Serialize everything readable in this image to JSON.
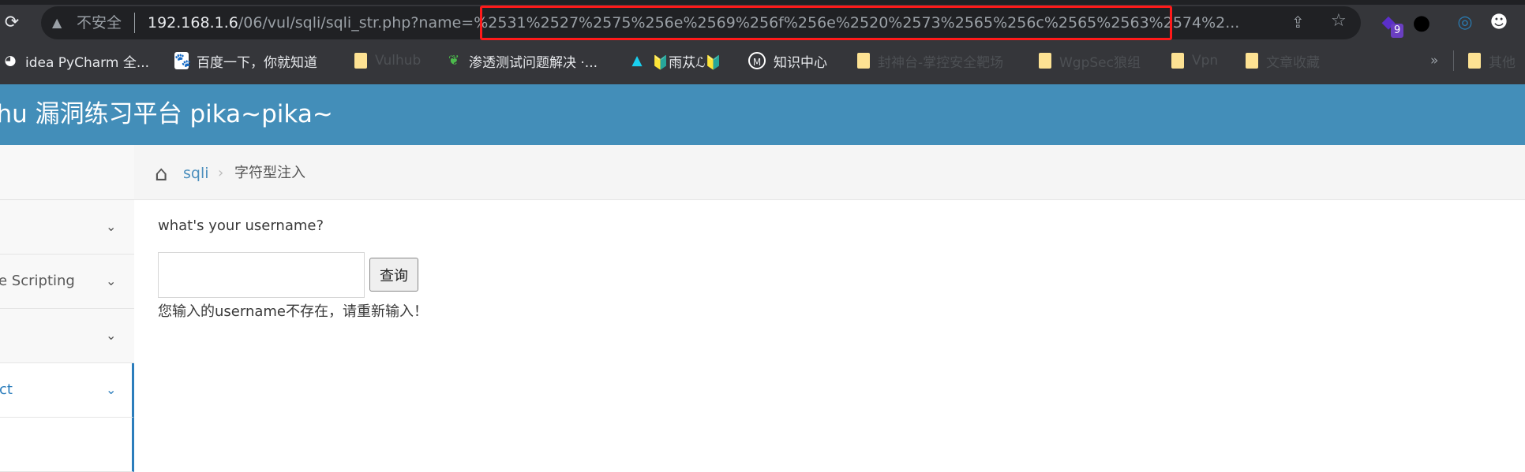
{
  "browser": {
    "security_label": "不安全",
    "url_host": "192.168.1.6",
    "url_path": "/06/vul/sqli/sqli_str.php?name",
    "url_query": "=%2531%2527%2575%256e%2569%256f%256e%2520%2573%2565%256c%2565%2563%2574%2...",
    "extension_badge": "9",
    "bookmarks": [
      {
        "label": "idea PyCharm 全...",
        "icon": "globe-icon"
      },
      {
        "label": "百度一下，你就知道",
        "icon": "baidu-icon"
      },
      {
        "label": "Vulhub",
        "icon": "folder-icon"
      },
      {
        "label": "渗透测试问题解决 ·...",
        "icon": "bird-icon"
      },
      {
        "label": "🔰雨苁ℒ🔰",
        "icon": "arrow-icon"
      },
      {
        "label": "知识中心",
        "icon": "m-icon"
      },
      {
        "label": "封神台-掌控安全靶场",
        "icon": "folder-icon"
      },
      {
        "label": "WgpSec狼组",
        "icon": "folder-icon"
      },
      {
        "label": "Vpn",
        "icon": "folder-icon"
      },
      {
        "label": "文章收藏",
        "icon": "folder-icon"
      }
    ],
    "more_bookmarks": "»",
    "other_bookmarks": "其他"
  },
  "header": {
    "title": "kachu 漏洞练习平台 pika~pika~"
  },
  "sidebar": {
    "items": [
      {
        "label": ""
      },
      {
        "label": "e Scripting"
      },
      {
        "label": ""
      },
      {
        "label": "ct",
        "active": true
      },
      {
        "label": ""
      }
    ]
  },
  "breadcrumb": {
    "parent": "sqli",
    "current": "字符型注入"
  },
  "main": {
    "question": "what's your username?",
    "input_value": "",
    "submit_label": "查询",
    "message": "您输入的username不存在，请重新输入！"
  },
  "colors": {
    "header": "#438eb9",
    "link": "#4c8fbd",
    "active": "#2b7dbc",
    "highlight_box": "#ff1a1a"
  }
}
